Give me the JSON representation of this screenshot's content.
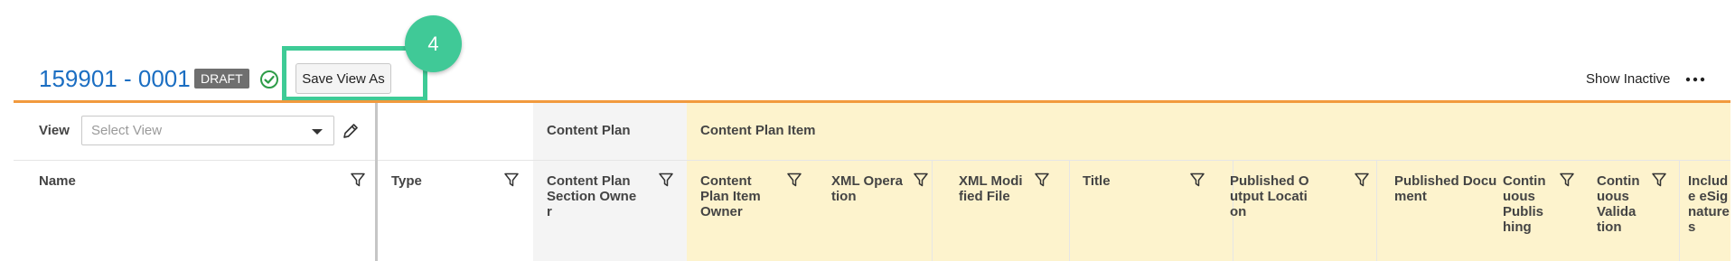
{
  "header": {
    "record_id": "159901 - 0001",
    "status_badge": "DRAFT",
    "save_view_as_label": "Save View As",
    "step_number": "4",
    "show_inactive_label": "Show Inactive",
    "more_icon": "more-horizontal-icon"
  },
  "view_bar": {
    "label": "View",
    "select_placeholder": "Select View",
    "edit_icon": "pencil-icon"
  },
  "column_groups": [
    {
      "label": ""
    },
    {
      "label": "Content Plan"
    },
    {
      "label": "Content Plan Item"
    }
  ],
  "columns": [
    {
      "label": "Name"
    },
    {
      "label": "Type"
    },
    {
      "label": "Content Plan Section Owner"
    },
    {
      "label": "Content Plan Item Owner"
    },
    {
      "label": "XML Operation"
    },
    {
      "label": "XML Modified File"
    },
    {
      "label": "Title"
    },
    {
      "label": "Published Output Location"
    },
    {
      "label": "Published Document"
    },
    {
      "label": "Continuous Publishing"
    },
    {
      "label": "Continuous Validation"
    },
    {
      "label": "Include eSignatures"
    }
  ],
  "colors": {
    "accent_orange": "#f19a3e",
    "highlight_green": "#3ecb96",
    "link_blue": "#1b6ec2",
    "group_gray": "#f4f4f4",
    "group_yellow": "#fdf3cd"
  }
}
